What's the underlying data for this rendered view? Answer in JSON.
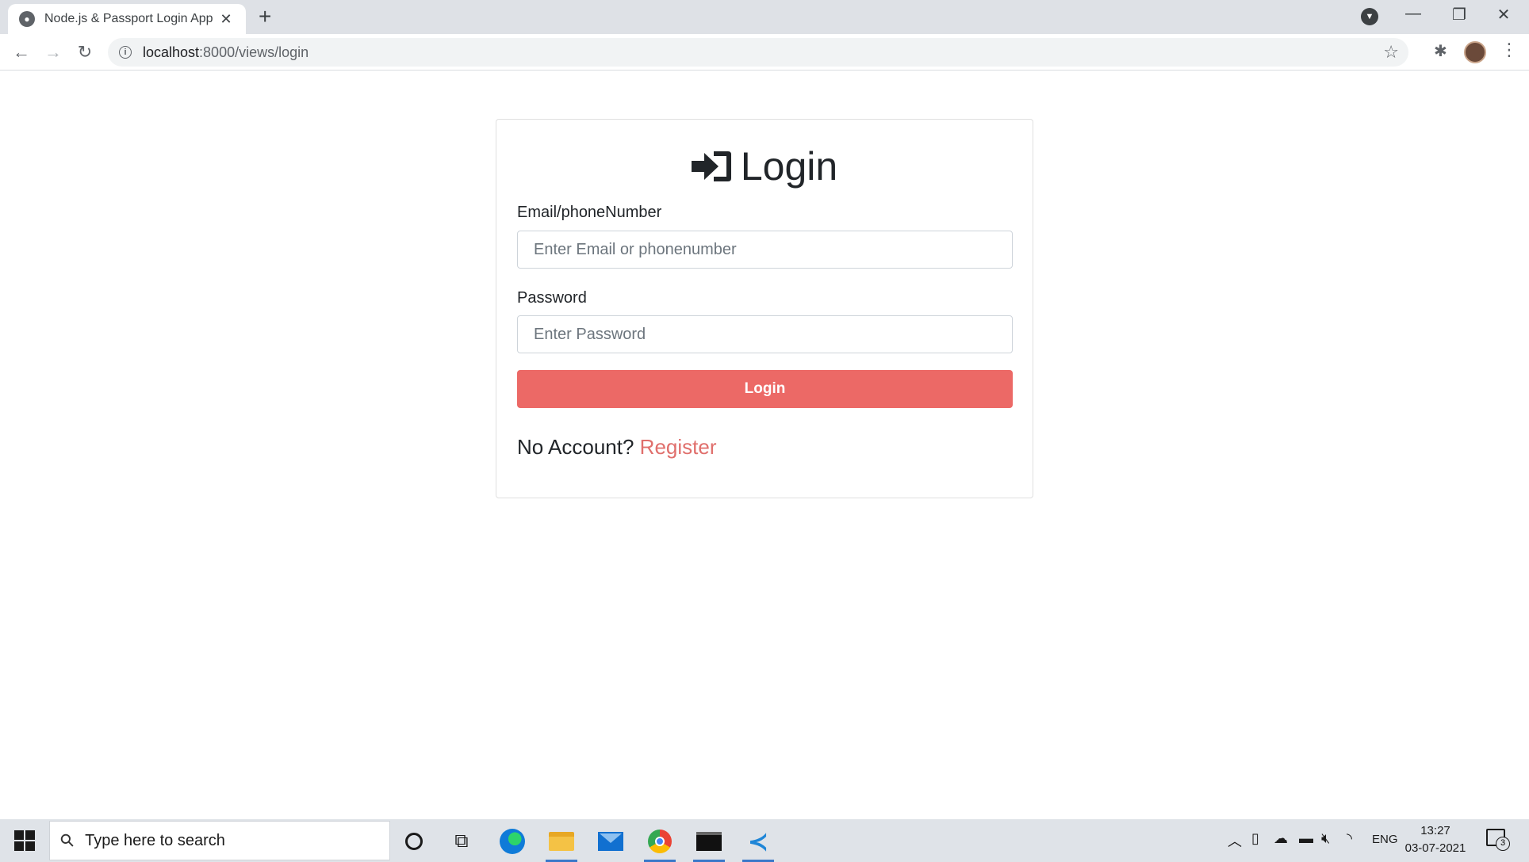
{
  "browser": {
    "tab_title": "Node.js & Passport Login App",
    "tab_close": "✕",
    "new_tab": "+",
    "url_host": "localhost",
    "url_path": ":8000/views/login",
    "window_controls": [
      "—",
      "❐",
      "✕"
    ]
  },
  "login": {
    "title": "Login",
    "email_label": "Email/phoneNumber",
    "email_placeholder": "Enter Email or phonenumber",
    "password_label": "Password",
    "password_placeholder": "Enter Password",
    "button_label": "Login",
    "no_account_text": "No Account?",
    "register_link": "Register",
    "accent_color": "#ec6966"
  },
  "taskbar": {
    "search_placeholder": "Type here to search",
    "language": "ENG",
    "time": "13:27",
    "date": "03-07-2021",
    "notification_count": "3"
  }
}
